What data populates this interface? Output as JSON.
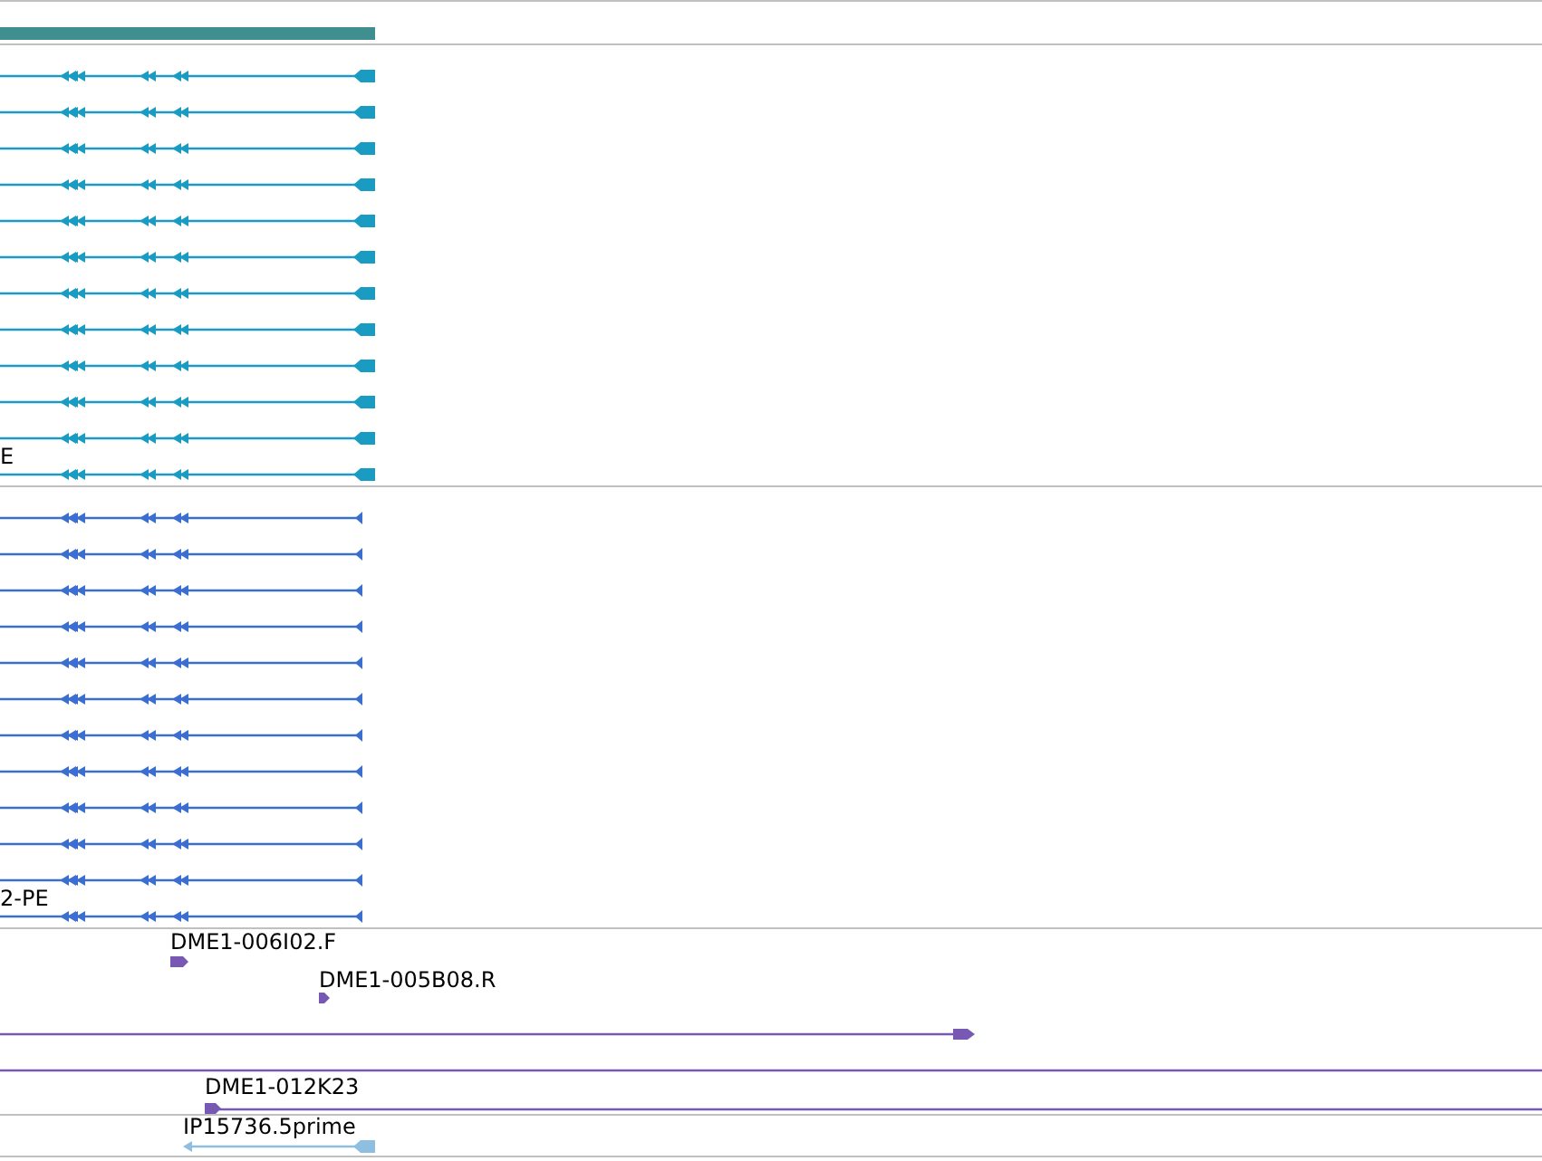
{
  "tracks": [
    {
      "kind": "transcripts",
      "color": "#1a9bc2",
      "thick_end": true,
      "rows": [
        {},
        {},
        {},
        {},
        {},
        {},
        {},
        {},
        {},
        {},
        {},
        {
          "label": "E"
        }
      ]
    },
    {
      "kind": "transcripts",
      "color": "#3a6fd0",
      "thick_end": false,
      "rows": [
        {},
        {},
        {},
        {},
        {},
        {},
        {},
        {},
        {},
        {},
        {},
        {
          "label": "2-PE"
        }
      ]
    },
    {
      "kind": "features",
      "color": "#7759b3",
      "items": [
        {
          "kind": "read",
          "label": "DME1-006I02.F"
        },
        {
          "kind": "read",
          "label": "DME1-005B08.R"
        },
        {
          "kind": "span"
        },
        {
          "kind": "span"
        },
        {
          "kind": "clone",
          "label": "DME1-012K23"
        }
      ]
    },
    {
      "kind": "features",
      "color": "#8fbfe0",
      "items": [
        {
          "kind": "est",
          "label": "IP15736.5prime"
        }
      ]
    }
  ]
}
